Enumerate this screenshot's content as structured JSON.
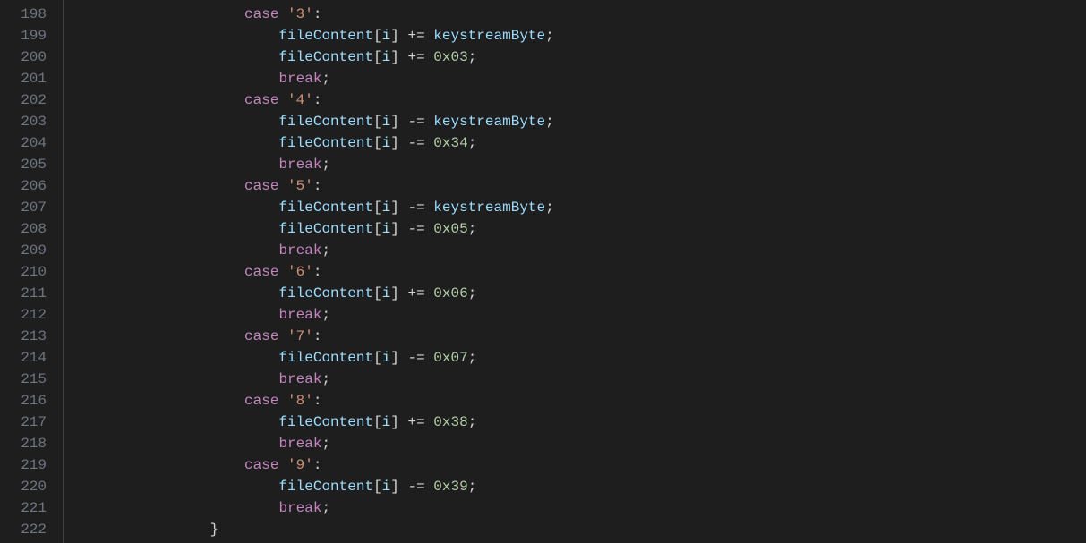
{
  "line_numbers": [
    "198",
    "199",
    "200",
    "201",
    "202",
    "203",
    "204",
    "205",
    "206",
    "207",
    "208",
    "209",
    "210",
    "211",
    "212",
    "213",
    "214",
    "215",
    "216",
    "217",
    "218",
    "219",
    "220",
    "221",
    "222"
  ],
  "code_lines": [
    {
      "indent": 20,
      "tokens": [
        {
          "t": "case ",
          "c": "kw"
        },
        {
          "t": "'3'",
          "c": "str"
        },
        {
          "t": ":",
          "c": "punc"
        }
      ]
    },
    {
      "indent": 24,
      "tokens": [
        {
          "t": "fileContent",
          "c": "var"
        },
        {
          "t": "[",
          "c": "punc"
        },
        {
          "t": "i",
          "c": "var"
        },
        {
          "t": "] += ",
          "c": "punc"
        },
        {
          "t": "keystreamByte",
          "c": "var"
        },
        {
          "t": ";",
          "c": "punc"
        }
      ]
    },
    {
      "indent": 24,
      "tokens": [
        {
          "t": "fileContent",
          "c": "var"
        },
        {
          "t": "[",
          "c": "punc"
        },
        {
          "t": "i",
          "c": "var"
        },
        {
          "t": "] += ",
          "c": "punc"
        },
        {
          "t": "0x03",
          "c": "num"
        },
        {
          "t": ";",
          "c": "punc"
        }
      ]
    },
    {
      "indent": 24,
      "tokens": [
        {
          "t": "break",
          "c": "kw"
        },
        {
          "t": ";",
          "c": "punc"
        }
      ]
    },
    {
      "indent": 20,
      "tokens": [
        {
          "t": "case ",
          "c": "kw"
        },
        {
          "t": "'4'",
          "c": "str"
        },
        {
          "t": ":",
          "c": "punc"
        }
      ]
    },
    {
      "indent": 24,
      "tokens": [
        {
          "t": "fileContent",
          "c": "var"
        },
        {
          "t": "[",
          "c": "punc"
        },
        {
          "t": "i",
          "c": "var"
        },
        {
          "t": "] -= ",
          "c": "punc"
        },
        {
          "t": "keystreamByte",
          "c": "var"
        },
        {
          "t": ";",
          "c": "punc"
        }
      ]
    },
    {
      "indent": 24,
      "tokens": [
        {
          "t": "fileContent",
          "c": "var"
        },
        {
          "t": "[",
          "c": "punc"
        },
        {
          "t": "i",
          "c": "var"
        },
        {
          "t": "] -= ",
          "c": "punc"
        },
        {
          "t": "0x34",
          "c": "num"
        },
        {
          "t": ";",
          "c": "punc"
        }
      ]
    },
    {
      "indent": 24,
      "tokens": [
        {
          "t": "break",
          "c": "kw"
        },
        {
          "t": ";",
          "c": "punc"
        }
      ]
    },
    {
      "indent": 20,
      "tokens": [
        {
          "t": "case ",
          "c": "kw"
        },
        {
          "t": "'5'",
          "c": "str"
        },
        {
          "t": ":",
          "c": "punc"
        }
      ]
    },
    {
      "indent": 24,
      "tokens": [
        {
          "t": "fileContent",
          "c": "var"
        },
        {
          "t": "[",
          "c": "punc"
        },
        {
          "t": "i",
          "c": "var"
        },
        {
          "t": "] -= ",
          "c": "punc"
        },
        {
          "t": "keystreamByte",
          "c": "var"
        },
        {
          "t": ";",
          "c": "punc"
        }
      ]
    },
    {
      "indent": 24,
      "tokens": [
        {
          "t": "fileContent",
          "c": "var"
        },
        {
          "t": "[",
          "c": "punc"
        },
        {
          "t": "i",
          "c": "var"
        },
        {
          "t": "] -= ",
          "c": "punc"
        },
        {
          "t": "0x05",
          "c": "num"
        },
        {
          "t": ";",
          "c": "punc"
        }
      ]
    },
    {
      "indent": 24,
      "tokens": [
        {
          "t": "break",
          "c": "kw"
        },
        {
          "t": ";",
          "c": "punc"
        }
      ]
    },
    {
      "indent": 20,
      "tokens": [
        {
          "t": "case ",
          "c": "kw"
        },
        {
          "t": "'6'",
          "c": "str"
        },
        {
          "t": ":",
          "c": "punc"
        }
      ]
    },
    {
      "indent": 24,
      "tokens": [
        {
          "t": "fileContent",
          "c": "var"
        },
        {
          "t": "[",
          "c": "punc"
        },
        {
          "t": "i",
          "c": "var"
        },
        {
          "t": "] += ",
          "c": "punc"
        },
        {
          "t": "0x06",
          "c": "num"
        },
        {
          "t": ";",
          "c": "punc"
        }
      ]
    },
    {
      "indent": 24,
      "tokens": [
        {
          "t": "break",
          "c": "kw"
        },
        {
          "t": ";",
          "c": "punc"
        }
      ]
    },
    {
      "indent": 20,
      "tokens": [
        {
          "t": "case ",
          "c": "kw"
        },
        {
          "t": "'7'",
          "c": "str"
        },
        {
          "t": ":",
          "c": "punc"
        }
      ]
    },
    {
      "indent": 24,
      "tokens": [
        {
          "t": "fileContent",
          "c": "var"
        },
        {
          "t": "[",
          "c": "punc"
        },
        {
          "t": "i",
          "c": "var"
        },
        {
          "t": "] -= ",
          "c": "punc"
        },
        {
          "t": "0x07",
          "c": "num"
        },
        {
          "t": ";",
          "c": "punc"
        }
      ]
    },
    {
      "indent": 24,
      "tokens": [
        {
          "t": "break",
          "c": "kw"
        },
        {
          "t": ";",
          "c": "punc"
        }
      ]
    },
    {
      "indent": 20,
      "tokens": [
        {
          "t": "case ",
          "c": "kw"
        },
        {
          "t": "'8'",
          "c": "str"
        },
        {
          "t": ":",
          "c": "punc"
        }
      ]
    },
    {
      "indent": 24,
      "tokens": [
        {
          "t": "fileContent",
          "c": "var"
        },
        {
          "t": "[",
          "c": "punc"
        },
        {
          "t": "i",
          "c": "var"
        },
        {
          "t": "] += ",
          "c": "punc"
        },
        {
          "t": "0x38",
          "c": "num"
        },
        {
          "t": ";",
          "c": "punc"
        }
      ]
    },
    {
      "indent": 24,
      "tokens": [
        {
          "t": "break",
          "c": "kw"
        },
        {
          "t": ";",
          "c": "punc"
        }
      ]
    },
    {
      "indent": 20,
      "tokens": [
        {
          "t": "case ",
          "c": "kw"
        },
        {
          "t": "'9'",
          "c": "str"
        },
        {
          "t": ":",
          "c": "punc"
        }
      ]
    },
    {
      "indent": 24,
      "tokens": [
        {
          "t": "fileContent",
          "c": "var"
        },
        {
          "t": "[",
          "c": "punc"
        },
        {
          "t": "i",
          "c": "var"
        },
        {
          "t": "] -= ",
          "c": "punc"
        },
        {
          "t": "0x39",
          "c": "num"
        },
        {
          "t": ";",
          "c": "punc"
        }
      ]
    },
    {
      "indent": 24,
      "tokens": [
        {
          "t": "break",
          "c": "kw"
        },
        {
          "t": ";",
          "c": "punc"
        }
      ]
    },
    {
      "indent": 16,
      "tokens": [
        {
          "t": "}",
          "c": "punc"
        }
      ]
    }
  ]
}
